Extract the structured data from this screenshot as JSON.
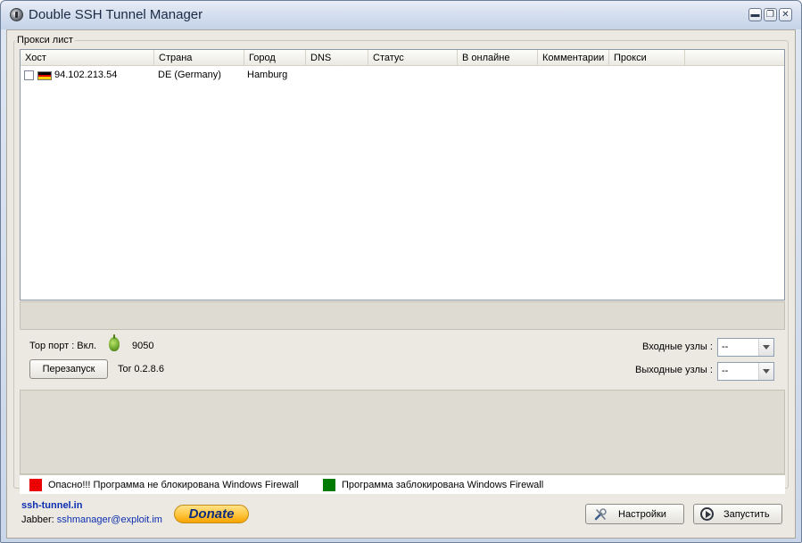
{
  "window": {
    "title": "Double SSH Tunnel Manager",
    "controls": {
      "minimize": "▬",
      "restore": "❐",
      "close": "✕"
    }
  },
  "proxy_group": {
    "legend": "Прокси лист",
    "columns": [
      "Хост",
      "Страна",
      "Город",
      "DNS",
      "Статус",
      "В онлайне",
      "Комментарии",
      "Прокси"
    ],
    "rows": [
      {
        "checked": false,
        "flag": "de-flag-icon",
        "host": "94.102.213.54",
        "country": "DE (Germany)",
        "city": "Hamburg",
        "dns": "",
        "status": "",
        "online": "",
        "comment": "",
        "proxy": ""
      }
    ]
  },
  "tor": {
    "port_label": "Тор порт : Вкл.",
    "port_value": "9050",
    "restart_label": "Перезапуск",
    "version": "Tor 0.2.8.6"
  },
  "nodes": {
    "entry_label": "Входные узлы :",
    "entry_value": "--",
    "exit_label": "Выходные узлы :",
    "exit_value": "--"
  },
  "firewall_legend": {
    "danger_text": "Опасно!!! Программа не блокирована Windows Firewall",
    "danger_color": "#ee0000",
    "blocked_text": "Программа заблокирована Windows Firewall",
    "blocked_color": "#007a00"
  },
  "footer": {
    "site": "ssh-tunnel.in",
    "jabber_label": "Jabber:",
    "jabber_address": "sshmanager@exploit.im",
    "donate_label": "Donate",
    "settings_label": "Настройки",
    "start_label": "Запустить"
  }
}
